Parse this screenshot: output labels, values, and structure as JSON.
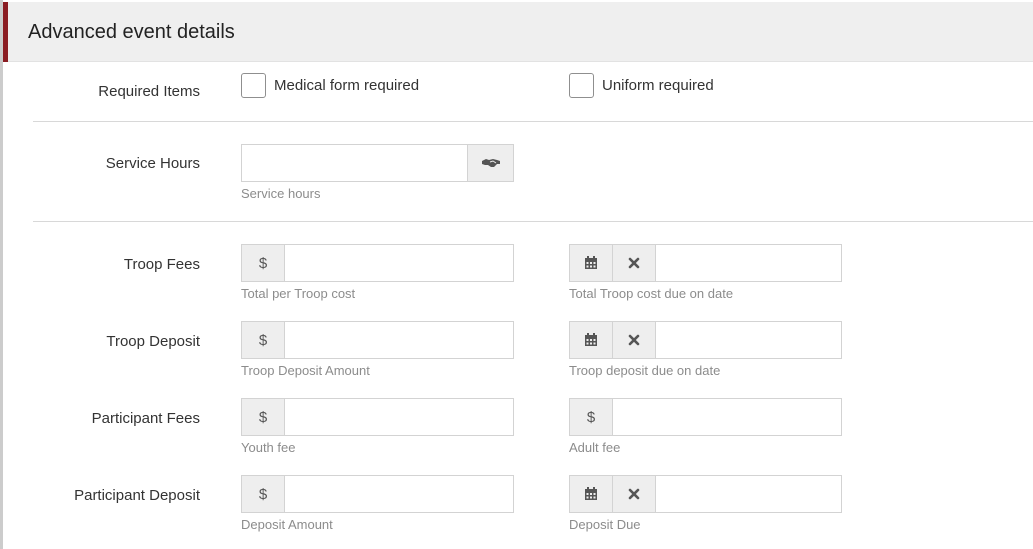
{
  "header": {
    "title": "Advanced event details"
  },
  "required": {
    "label": "Required Items",
    "medical": "Medical form required",
    "uniform": "Uniform required"
  },
  "service": {
    "label": "Service Hours",
    "help": "Service hours",
    "icon": "handshake-icon"
  },
  "troop_fees": {
    "label": "Troop Fees",
    "currency": "$",
    "help_cost": "Total per Troop cost",
    "help_due": "Total Troop cost due on date"
  },
  "troop_deposit": {
    "label": "Troop Deposit",
    "currency": "$",
    "help_amount": "Troop Deposit Amount",
    "help_due": "Troop deposit due on date"
  },
  "participant_fees": {
    "label": "Participant Fees",
    "currency": "$",
    "help_youth": "Youth fee",
    "help_adult": "Adult fee"
  },
  "participant_deposit": {
    "label": "Participant Deposit",
    "currency": "$",
    "help_amount": "Deposit Amount",
    "help_due": "Deposit Due"
  },
  "colors": {
    "accent": "#8a1c22",
    "header_bg": "#efefef",
    "help_text": "#8c8c8c"
  }
}
